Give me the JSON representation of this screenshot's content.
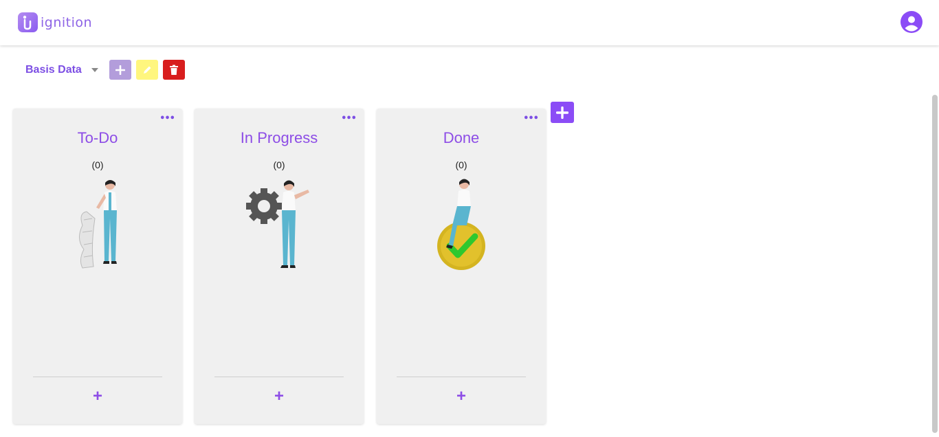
{
  "app": {
    "logo_text": "ignition"
  },
  "toolbar": {
    "board_name": "Basis Data"
  },
  "colors": {
    "accent": "#8b4cf6",
    "edit": "#fff67e",
    "delete": "#d81e1e",
    "add_light": "#b39ddb"
  },
  "columns": [
    {
      "title": "To-Do",
      "count": "(0)",
      "menu": "•••",
      "add_label": "+",
      "illustration": "woman-with-checklist"
    },
    {
      "title": "In Progress",
      "count": "(0)",
      "menu": "•••",
      "add_label": "+",
      "illustration": "woman-with-gear"
    },
    {
      "title": "Done",
      "count": "(0)",
      "menu": "•••",
      "add_label": "+",
      "illustration": "woman-on-checkmark"
    }
  ],
  "icons": {
    "avatar": "user-circle-icon",
    "add": "plus-icon",
    "edit": "pencil-icon",
    "delete": "trash-icon"
  }
}
